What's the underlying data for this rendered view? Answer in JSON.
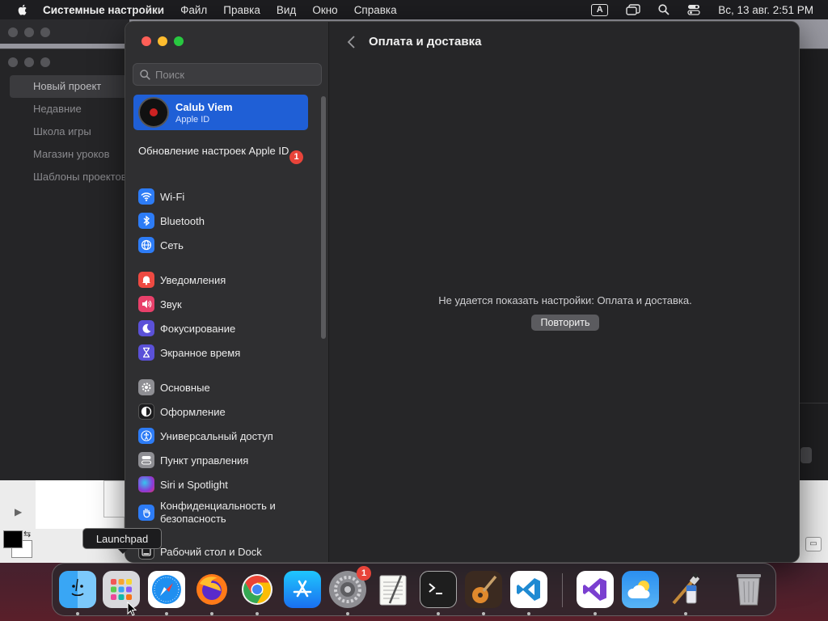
{
  "menubar": {
    "app_name": "Системные настройки",
    "items": [
      "Файл",
      "Правка",
      "Вид",
      "Окно",
      "Справка"
    ],
    "input_source": "A",
    "datetime": "Вс, 13 авг.  2:51 PM"
  },
  "background_window": {
    "sidebar": [
      "Новый проект",
      "Недавние",
      "Школа игры",
      "Магазин уроков",
      "Шаблоны проектов"
    ]
  },
  "settings": {
    "search_placeholder": "Поиск",
    "account": {
      "name": "Calub Viem",
      "subtitle": "Apple ID"
    },
    "update": {
      "label": "Обновление настроек Apple ID",
      "badge": "1"
    },
    "nav_items": [
      {
        "label": "Wi-Fi",
        "icon": "wifi-icon",
        "color": "#2d7cf6"
      },
      {
        "label": "Bluetooth",
        "icon": "bluetooth-icon",
        "color": "#2d7cf6"
      },
      {
        "label": "Сеть",
        "icon": "globe-icon",
        "color": "#2d7cf6"
      },
      {
        "label": "Уведомления",
        "icon": "bell-icon",
        "color": "#ee4a42"
      },
      {
        "label": "Звук",
        "icon": "speaker-icon",
        "color": "#e8406a"
      },
      {
        "label": "Фокусирование",
        "icon": "moon-icon",
        "color": "#5b51d8"
      },
      {
        "label": "Экранное время",
        "icon": "hourglass-icon",
        "color": "#5b51d8"
      },
      {
        "label": "Основные",
        "icon": "gear-icon",
        "color": "#8e8e93"
      },
      {
        "label": "Оформление",
        "icon": "appearance-icon",
        "color": "#1c1c1e"
      },
      {
        "label": "Универсальный доступ",
        "icon": "accessibility-icon",
        "color": "#2d7cf6"
      },
      {
        "label": "Пункт управления",
        "icon": "control-center-icon",
        "color": "#8e8e93"
      },
      {
        "label": "Siri и Spotlight",
        "icon": "siri-icon",
        "color": "#8a3ad6"
      },
      {
        "label": "Конфиденциальность и безопасность",
        "icon": "hand-icon",
        "color": "#2d7cf6"
      },
      {
        "label": "Рабочий стол и Dock",
        "icon": "dock-icon",
        "color": "#1c1c1e"
      }
    ],
    "content": {
      "title": "Оплата и доставка",
      "error": "Не удается показать настройки: Оплата и доставка.",
      "retry": "Повторить"
    }
  },
  "tooltip": "Launchpad",
  "dock": {
    "items": [
      {
        "name": "Finder",
        "icon": "finder-icon"
      },
      {
        "name": "Launchpad",
        "icon": "launchpad-icon"
      },
      {
        "name": "Safari",
        "icon": "safari-icon"
      },
      {
        "name": "Firefox",
        "icon": "firefox-icon"
      },
      {
        "name": "Chrome",
        "icon": "chrome-icon"
      },
      {
        "name": "App Store",
        "icon": "app-store-icon"
      },
      {
        "name": "Системные настройки",
        "icon": "system-settings-icon",
        "badge": "1"
      },
      {
        "name": "TextEdit",
        "icon": "textedit-icon"
      },
      {
        "name": "Terminal",
        "icon": "terminal-icon"
      },
      {
        "name": "GarageBand",
        "icon": "garageband-icon"
      },
      {
        "name": "VS Code",
        "icon": "vscode-icon"
      },
      {
        "name": "Visual Studio",
        "icon": "visual-studio-icon"
      },
      {
        "name": "Погода",
        "icon": "weather-icon"
      },
      {
        "name": "Paintbrush",
        "icon": "paintbrush-icon"
      },
      {
        "name": "Корзина",
        "icon": "trash-icon"
      }
    ]
  }
}
